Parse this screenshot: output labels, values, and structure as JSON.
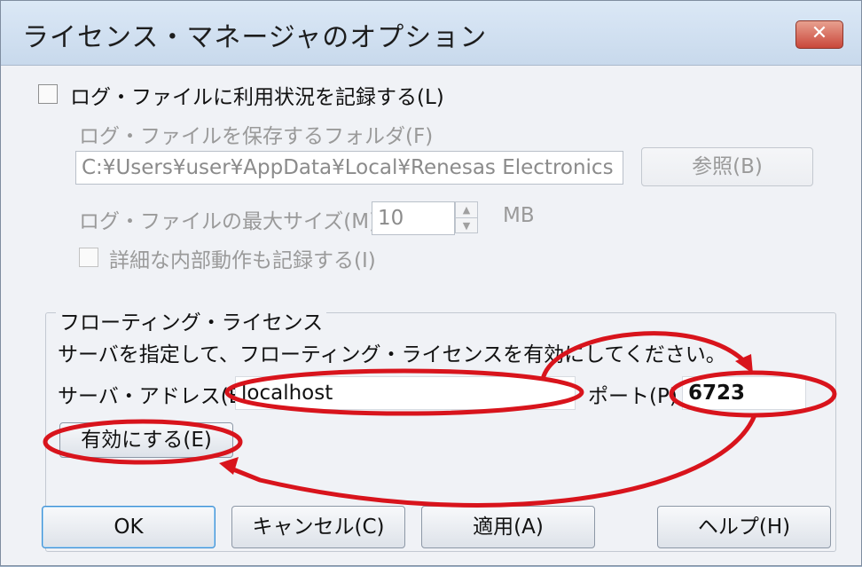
{
  "window": {
    "title": "ライセンス・マネージャのオプション",
    "close_label": "✕"
  },
  "log": {
    "enable_label": "ログ・ファイルに利用状況を記録する(L)",
    "enable_checked": false,
    "folder_label": "ログ・ファイルを保存するフォルダ(F)",
    "folder_value": "C:¥Users¥user¥AppData¥Local¥Renesas Electronics",
    "browse_label": "参照(B)",
    "max_size_label": "ログ・ファイルの最大サイズ(M)",
    "max_size_value": "10",
    "max_size_unit": "MB",
    "detail_label": "詳細な内部動作も記録する(I)",
    "detail_checked": false
  },
  "floating": {
    "group_title": "フローティング・ライセンス",
    "description": "サーバを指定して、フローティング・ライセンスを有効にしてください。",
    "server_label": "サーバ・アドレス(E)",
    "server_value": "localhost",
    "port_label": "ポート(P)",
    "port_value": "6723",
    "enable_button": "有効にする(E)"
  },
  "buttons": {
    "ok": "OK",
    "cancel": "キャンセル(C)",
    "apply": "適用(A)",
    "help": "ヘルプ(H)"
  },
  "colors": {
    "annotation": "#d8141c",
    "titlebar": "#c8d9ec",
    "dialog_bg": "#f0f2f6"
  }
}
